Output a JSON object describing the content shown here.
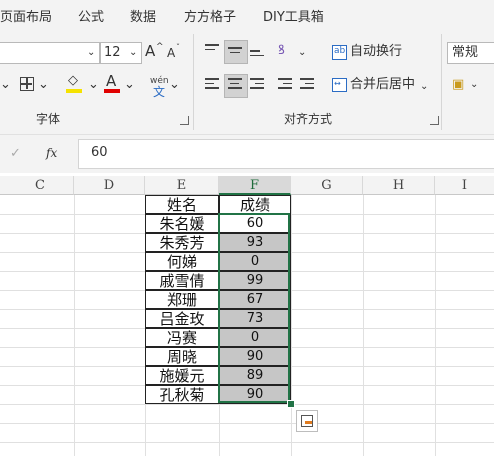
{
  "tabs": [
    "页面布局",
    "公式",
    "数据",
    "方方格子",
    "DIY工具箱"
  ],
  "font_group": {
    "font_size": "12",
    "grow_font": "A",
    "shrink_font": "A",
    "font_color_glyph": "A",
    "phonetic_glyph": "wén",
    "phonetic_char": "文",
    "label": "字体"
  },
  "align_group": {
    "wrap_text": "自动换行",
    "merge_center": "合并后居中",
    "label": "对齐方式"
  },
  "number_group": {
    "format": "常规"
  },
  "formula_bar": {
    "fx": "fx",
    "value": "60"
  },
  "columns": [
    "C",
    "D",
    "E",
    "F",
    "G",
    "H",
    "I"
  ],
  "table": {
    "header_name": "姓名",
    "header_score": "成绩",
    "rows": [
      {
        "name": "朱名媛",
        "score": "60"
      },
      {
        "name": "朱秀芳",
        "score": "93"
      },
      {
        "name": "何娣",
        "score": "0"
      },
      {
        "name": "戚雪倩",
        "score": "99"
      },
      {
        "name": "郑珊",
        "score": "67"
      },
      {
        "name": "吕金玫",
        "score": "73"
      },
      {
        "name": "冯赛",
        "score": "0"
      },
      {
        "name": "周晓",
        "score": "90"
      },
      {
        "name": "施媛元",
        "score": "89"
      },
      {
        "name": "孔秋菊",
        "score": "90"
      }
    ]
  },
  "colors": {
    "selection": "#217346",
    "font_underline": "#e00000",
    "highlight": "#f5e200"
  }
}
